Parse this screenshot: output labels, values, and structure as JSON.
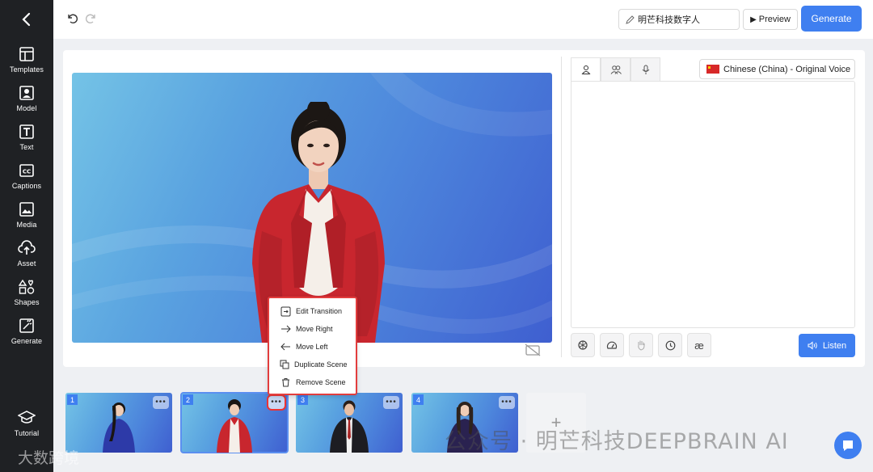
{
  "sidebar": {
    "items": [
      {
        "label": "Templates",
        "icon": "layout-icon"
      },
      {
        "label": "Model",
        "icon": "person-frame-icon"
      },
      {
        "label": "Text",
        "icon": "text-t-icon"
      },
      {
        "label": "Captions",
        "icon": "cc-icon"
      },
      {
        "label": "Media",
        "icon": "image-icon"
      },
      {
        "label": "Asset",
        "icon": "cloud-upload-icon"
      },
      {
        "label": "Shapes",
        "icon": "shapes-icon"
      },
      {
        "label": "Generate",
        "icon": "generate-icon"
      }
    ],
    "tutorial": "Tutorial"
  },
  "topbar": {
    "project_title": "明芒科技数字人",
    "preview_label": "Preview",
    "generate_label": "Generate"
  },
  "script_panel": {
    "voice": "Chinese (China) - Original Voice",
    "listen_label": "Listen",
    "tool_icons": [
      "openai-icon",
      "speed-icon",
      "gesture-icon",
      "pause-icon",
      "pronunciation-icon"
    ],
    "tool_ae": "æ"
  },
  "context_menu": {
    "items": [
      "Edit Transition",
      "Move Right",
      "Move Left",
      "Duplicate Scene",
      "Remove Scene"
    ]
  },
  "timeline": {
    "scenes": [
      "1",
      "2",
      "3",
      "4"
    ],
    "more": "•••",
    "add": "+"
  },
  "watermarks": {
    "right": "公众号 · 明芒科技DEEPBRAIN AI",
    "left": "大数跨境"
  },
  "colors": {
    "accent": "#3f7ff0",
    "sidebar_bg": "#1f2124",
    "highlight": "#e23d3d"
  }
}
